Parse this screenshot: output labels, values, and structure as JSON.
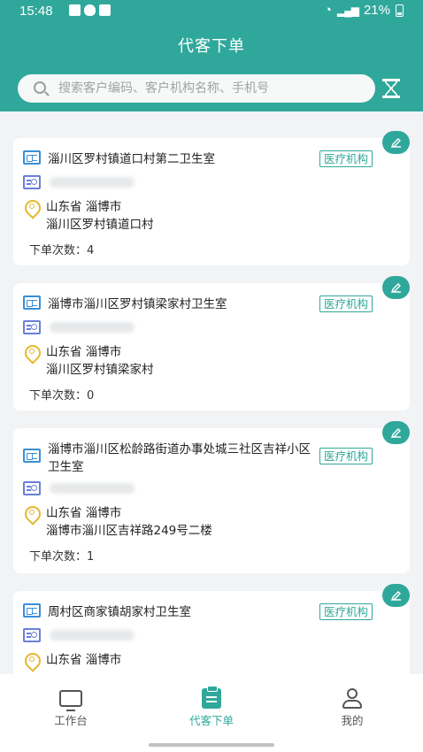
{
  "status_bar": {
    "time": "15:48",
    "battery": "21%"
  },
  "header": {
    "title": "代客下单"
  },
  "search": {
    "placeholder": "搜索客户编码、客户机构名称、手机号"
  },
  "customers": [
    {
      "name": "淄川区罗村镇道口村第二卫生室",
      "tag": "医疗机构",
      "province_city": "山东省 淄博市",
      "address": "淄川区罗村镇道口村",
      "order_count": "下单次数：4"
    },
    {
      "name": "淄博市淄川区罗村镇梁家村卫生室",
      "tag": "医疗机构",
      "province_city": "山东省 淄博市",
      "address": "淄川区罗村镇梁家村",
      "order_count": "下单次数：0"
    },
    {
      "name": "淄博市淄川区松龄路街道办事处城三社区吉祥小区卫生室",
      "tag": "医疗机构",
      "province_city": "山东省 淄博市",
      "address": "淄博市淄川区吉祥路249号二楼",
      "order_count": "下单次数：1"
    },
    {
      "name": "周村区商家镇胡家村卫生室",
      "tag": "医疗机构",
      "province_city": "山东省 淄博市",
      "address": "",
      "order_count": ""
    }
  ],
  "tabbar": {
    "tabs": [
      {
        "label": "工作台",
        "icon": "monitor-icon"
      },
      {
        "label": "代客下单",
        "icon": "clipboard-icon",
        "active": true
      },
      {
        "label": "我的",
        "icon": "user-icon"
      }
    ]
  },
  "colors": {
    "primary": "#2fa89b",
    "tag_border": "#2fa89b",
    "pin": "#e6b82d"
  }
}
